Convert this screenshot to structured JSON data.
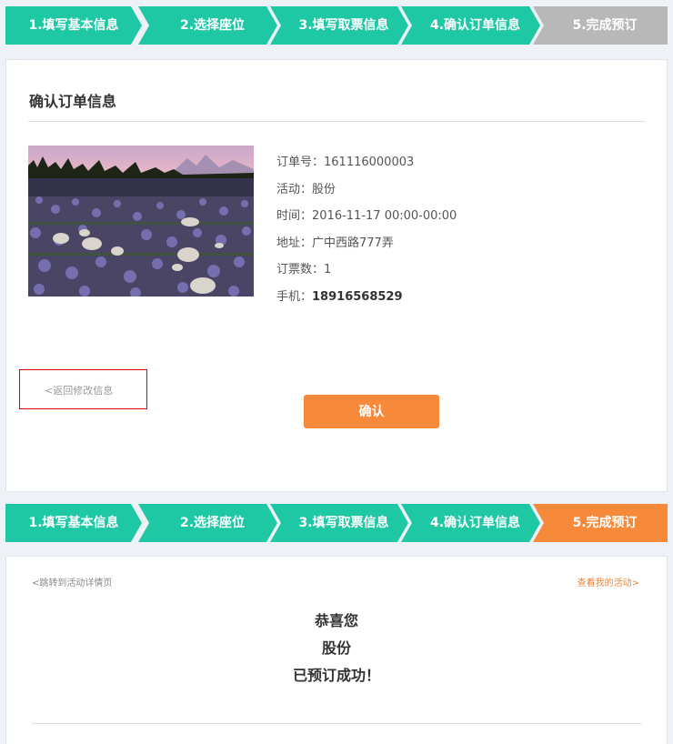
{
  "colors": {
    "step_active": "#1ec8a5",
    "step_inactive": "#b8b8b8",
    "step_done": "#f6893a",
    "accent": "#f6893a"
  },
  "steps": [
    "1.填写基本信息",
    "2.选择座位",
    "3.填写取票信息",
    "4.确认订单信息",
    "5.完成预订"
  ],
  "confirm": {
    "title": "确认订单信息",
    "photo_icon": "event-photo",
    "fields": [
      {
        "label": "订单号：",
        "value": "161116000003"
      },
      {
        "label": "活动：",
        "value": "股份"
      },
      {
        "label": "时间：",
        "value": "2016-11-17 00:00-00:00"
      },
      {
        "label": "地址：",
        "value": "广中西路777弄"
      },
      {
        "label": "订票数：",
        "value": "1"
      },
      {
        "label": "手机：",
        "value": "18916568529"
      }
    ],
    "back_link": "<返回修改信息",
    "confirm_button": "确认"
  },
  "success": {
    "link_left": "<跳转到活动详情页",
    "link_right": "查看我的活动>",
    "line1": "恭喜您",
    "line2": "股份",
    "line3": "已预订成功！"
  }
}
